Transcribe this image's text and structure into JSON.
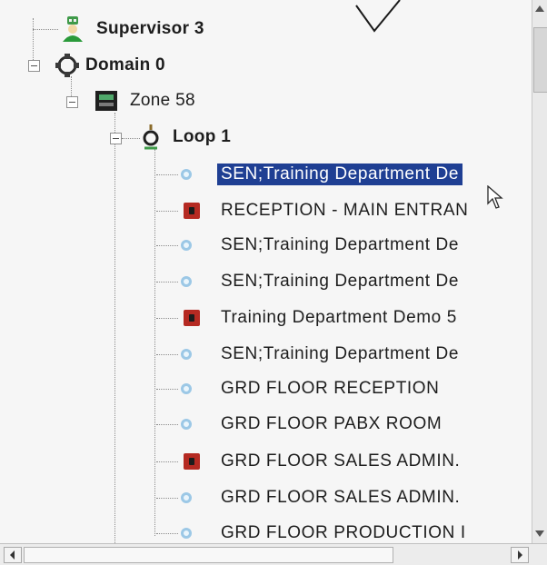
{
  "tree": {
    "supervisor": "Supervisor 3",
    "domain": "Domain 0",
    "zone": "Zone 58",
    "loop": "Loop 1",
    "devices": [
      {
        "label": "SEN;Training Department De",
        "type": "sensor",
        "selected": true
      },
      {
        "label": "RECEPTION - MAIN ENTRAN",
        "type": "manual-call-point",
        "selected": false
      },
      {
        "label": "SEN;Training Department De",
        "type": "sensor",
        "selected": false
      },
      {
        "label": "SEN;Training Department De",
        "type": "sensor",
        "selected": false
      },
      {
        "label": "Training Department Demo 5",
        "type": "manual-call-point",
        "selected": false
      },
      {
        "label": "SEN;Training Department De",
        "type": "sensor",
        "selected": false
      },
      {
        "label": "GRD FLOOR RECEPTION",
        "type": "sensor",
        "selected": false
      },
      {
        "label": "GRD FLOOR PABX ROOM",
        "type": "sensor",
        "selected": false
      },
      {
        "label": "GRD FLOOR SALES ADMIN.",
        "type": "manual-call-point",
        "selected": false
      },
      {
        "label": "GRD FLOOR SALES ADMIN.",
        "type": "sensor",
        "selected": false
      },
      {
        "label": "GRD FLOOR PRODUCTION I",
        "type": "sensor",
        "selected": false
      }
    ]
  },
  "icons": {
    "supervisor": "supervisor-user-icon",
    "domain": "network-domain-icon",
    "zone": "zone-panel-icon",
    "loop": "loop-icon",
    "sensor": "sensor-icon",
    "manual-call-point": "manual-call-point-icon"
  },
  "colors": {
    "selection": "#1f3f93",
    "call_point": "#b52a22",
    "sensor": "#9cc8e6"
  }
}
